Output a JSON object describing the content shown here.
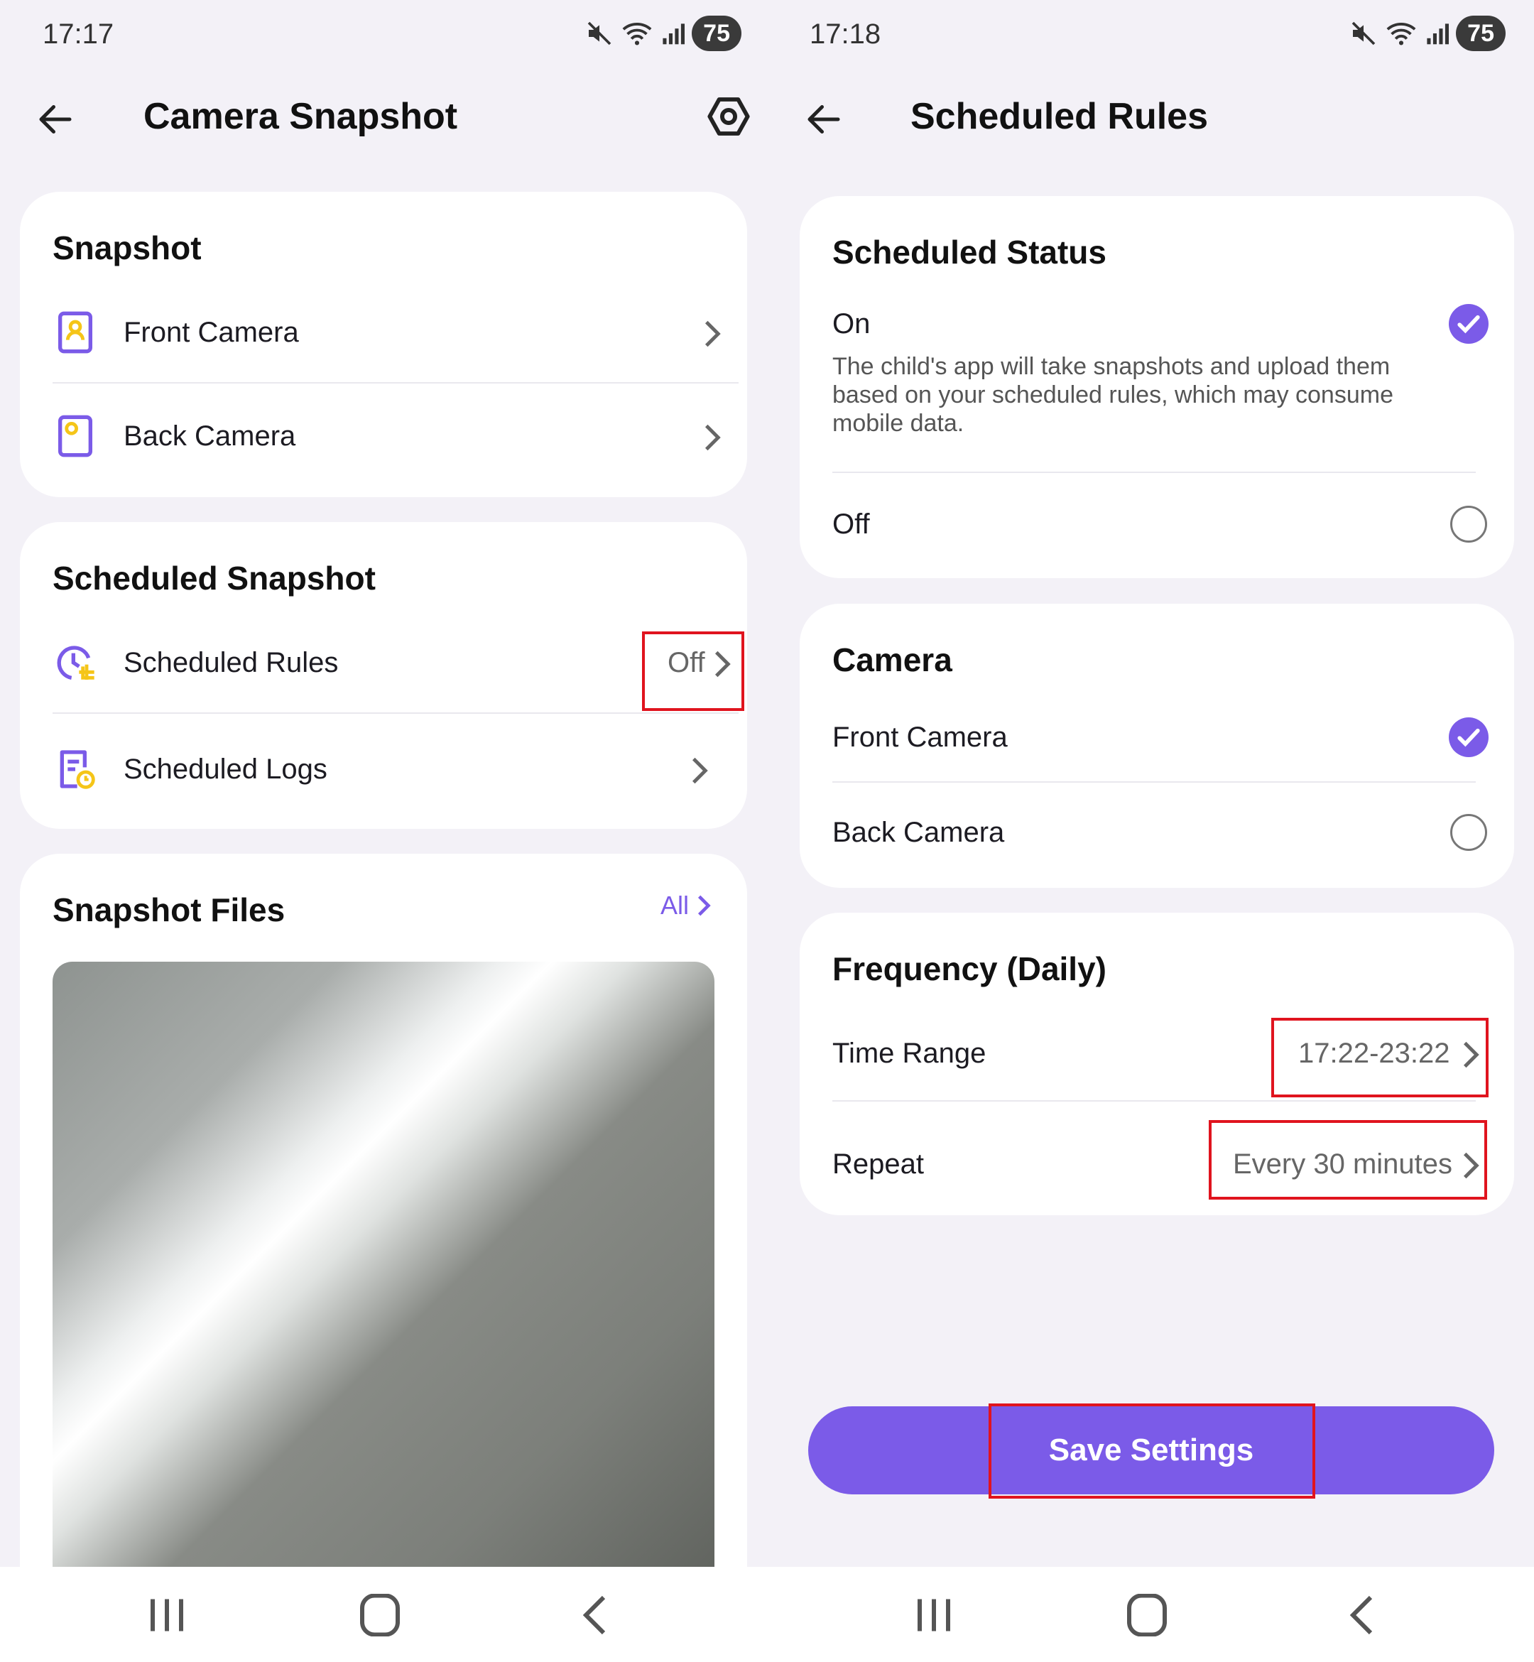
{
  "left": {
    "status": {
      "time": "17:17",
      "battery": "75"
    },
    "title": "Camera Snapshot",
    "snapshot": {
      "title": "Snapshot",
      "items": [
        {
          "label": "Front Camera"
        },
        {
          "label": "Back Camera"
        }
      ]
    },
    "scheduled": {
      "title": "Scheduled Snapshot",
      "rules_label": "Scheduled Rules",
      "rules_value": "Off",
      "logs_label": "Scheduled Logs"
    },
    "files": {
      "title": "Snapshot Files",
      "all_label": "All"
    }
  },
  "right": {
    "status": {
      "time": "17:18",
      "battery": "75"
    },
    "title": "Scheduled Rules",
    "status_card": {
      "title": "Scheduled Status",
      "on_label": "On",
      "on_desc": "The child's app will take snapshots and upload them based on your scheduled rules, which may consume mobile data.",
      "off_label": "Off",
      "selected": "On"
    },
    "camera_card": {
      "title": "Camera",
      "front_label": "Front Camera",
      "back_label": "Back Camera",
      "selected": "Front Camera"
    },
    "frequency_card": {
      "title": "Frequency (Daily)",
      "time_range_label": "Time Range",
      "time_range_value": "17:22-23:22",
      "repeat_label": "Repeat",
      "repeat_value": "Every 30 minutes"
    },
    "save_label": "Save Settings"
  },
  "colors": {
    "accent": "#7b5be8",
    "highlight": "#e0141e",
    "icon_yellow": "#f5c518"
  }
}
